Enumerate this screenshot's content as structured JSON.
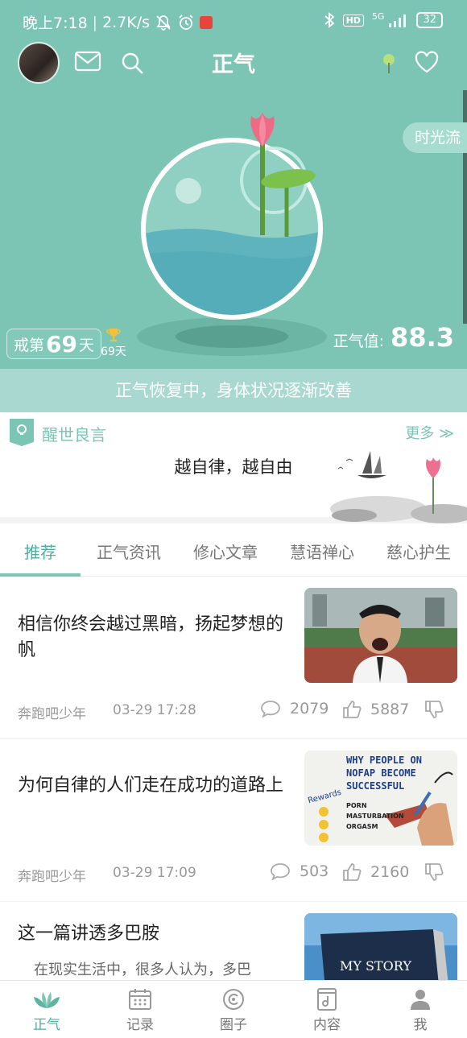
{
  "status_bar": {
    "time": "晚上7:18",
    "speed": "2.7K/s",
    "hd": "HD",
    "network": "5G",
    "battery": "32"
  },
  "header": {
    "title": "正气"
  },
  "hero": {
    "time_flow_label": "时光流",
    "streak_prefix": "戒第",
    "streak_days": "69",
    "streak_suffix": "天",
    "best_days": "69天",
    "score_label": "正气值:",
    "score_value": "88.3",
    "banner": "正气恢复中，身体状况逐渐改善"
  },
  "quote": {
    "section_title": "醒世良言",
    "more_label": "更多 ≫",
    "text": "越自律，越自由"
  },
  "tabs": [
    "推荐",
    "正气资讯",
    "修心文章",
    "慧语禅心",
    "慈心护生"
  ],
  "articles": [
    {
      "title": "相信你终会越过黑暗，扬起梦想的帆",
      "author": "奔跑吧少年",
      "time": "03-29 17:28",
      "comments": "2079",
      "likes": "5887"
    },
    {
      "title": "为何自律的人们走在成功的道路上",
      "author": "奔跑吧少年",
      "time": "03-29 17:09",
      "comments": "503",
      "likes": "2160",
      "thumb_text": {
        "line1": "WHY PEOPLE ON",
        "line2": "NOFAP BECOME",
        "line3": "SUCCESSFUL",
        "rewards": "Rewards",
        "porn": "PORN",
        "masturbation": "MASTURBATION",
        "orgasm": "ORGASM"
      }
    },
    {
      "title": "这一篇讲透多巴胺",
      "excerpt": "在现实生活中，很多人认为，多巴",
      "thumb_text": "MY STORY"
    }
  ],
  "bottom_nav": [
    "正气",
    "记录",
    "圈子",
    "内容",
    "我"
  ],
  "colors": {
    "accent": "#7cc5b5",
    "accent_dark": "#4fae9c",
    "banner": "#a8d8cf"
  }
}
